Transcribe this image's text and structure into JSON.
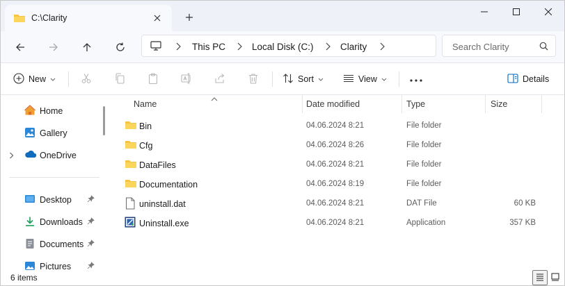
{
  "tab": {
    "title": "C:\\Clarity"
  },
  "window_controls": {
    "minimize": "minimize",
    "maximize": "maximize",
    "close": "close"
  },
  "address": {
    "crumbs": [
      "This PC",
      "Local Disk (C:)",
      "Clarity"
    ]
  },
  "search": {
    "placeholder": "Search Clarity"
  },
  "commands": {
    "new_label": "New",
    "sort_label": "Sort",
    "view_label": "View",
    "details_label": "Details"
  },
  "navigation": {
    "items": [
      {
        "label": "Home",
        "icon": "home-icon"
      },
      {
        "label": "Gallery",
        "icon": "gallery-icon"
      },
      {
        "label": "OneDrive",
        "icon": "cloud-icon"
      },
      {
        "label": "Desktop",
        "icon": "desktop-icon"
      },
      {
        "label": "Downloads",
        "icon": "download-icon"
      },
      {
        "label": "Documents",
        "icon": "documents-icon"
      },
      {
        "label": "Pictures",
        "icon": "pictures-icon"
      }
    ]
  },
  "columns": {
    "name": "Name",
    "date": "Date modified",
    "type": "Type",
    "size": "Size"
  },
  "files": [
    {
      "name": "Bin",
      "date": "04.06.2024 8:21",
      "type": "File folder",
      "size": ""
    },
    {
      "name": "Cfg",
      "date": "04.06.2024 8:26",
      "type": "File folder",
      "size": ""
    },
    {
      "name": "DataFiles",
      "date": "04.06.2024 8:21",
      "type": "File folder",
      "size": ""
    },
    {
      "name": "Documentation",
      "date": "04.06.2024 8:19",
      "type": "File folder",
      "size": ""
    },
    {
      "name": "uninstall.dat",
      "date": "04.06.2024 8:21",
      "type": "DAT File",
      "size": "60 KB"
    },
    {
      "name": "Uninstall.exe",
      "date": "04.06.2024 8:21",
      "type": "Application",
      "size": "357 KB"
    }
  ],
  "status": {
    "item_count": "6 items"
  },
  "colors": {
    "accent": "#0067c0",
    "folder": "#f6c342",
    "titlebar": "#eef1f8"
  }
}
